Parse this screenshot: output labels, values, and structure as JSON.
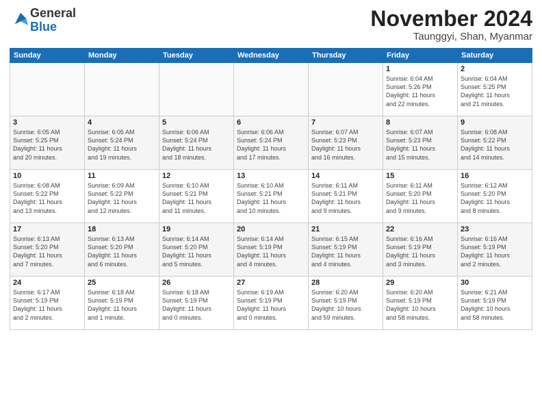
{
  "logo": {
    "general": "General",
    "blue": "Blue"
  },
  "title": "November 2024",
  "location": "Taunggyi, Shan, Myanmar",
  "weekdays": [
    "Sunday",
    "Monday",
    "Tuesday",
    "Wednesday",
    "Thursday",
    "Friday",
    "Saturday"
  ],
  "weeks": [
    [
      {
        "day": "",
        "info": ""
      },
      {
        "day": "",
        "info": ""
      },
      {
        "day": "",
        "info": ""
      },
      {
        "day": "",
        "info": ""
      },
      {
        "day": "",
        "info": ""
      },
      {
        "day": "1",
        "info": "Sunrise: 6:04 AM\nSunset: 5:26 PM\nDaylight: 11 hours\nand 22 minutes."
      },
      {
        "day": "2",
        "info": "Sunrise: 6:04 AM\nSunset: 5:25 PM\nDaylight: 11 hours\nand 21 minutes."
      }
    ],
    [
      {
        "day": "3",
        "info": "Sunrise: 6:05 AM\nSunset: 5:25 PM\nDaylight: 11 hours\nand 20 minutes."
      },
      {
        "day": "4",
        "info": "Sunrise: 6:05 AM\nSunset: 5:24 PM\nDaylight: 11 hours\nand 19 minutes."
      },
      {
        "day": "5",
        "info": "Sunrise: 6:06 AM\nSunset: 5:24 PM\nDaylight: 11 hours\nand 18 minutes."
      },
      {
        "day": "6",
        "info": "Sunrise: 6:06 AM\nSunset: 5:24 PM\nDaylight: 11 hours\nand 17 minutes."
      },
      {
        "day": "7",
        "info": "Sunrise: 6:07 AM\nSunset: 5:23 PM\nDaylight: 11 hours\nand 16 minutes."
      },
      {
        "day": "8",
        "info": "Sunrise: 6:07 AM\nSunset: 5:23 PM\nDaylight: 11 hours\nand 15 minutes."
      },
      {
        "day": "9",
        "info": "Sunrise: 6:08 AM\nSunset: 5:22 PM\nDaylight: 11 hours\nand 14 minutes."
      }
    ],
    [
      {
        "day": "10",
        "info": "Sunrise: 6:08 AM\nSunset: 5:22 PM\nDaylight: 11 hours\nand 13 minutes."
      },
      {
        "day": "11",
        "info": "Sunrise: 6:09 AM\nSunset: 5:22 PM\nDaylight: 11 hours\nand 12 minutes."
      },
      {
        "day": "12",
        "info": "Sunrise: 6:10 AM\nSunset: 5:21 PM\nDaylight: 11 hours\nand 11 minutes."
      },
      {
        "day": "13",
        "info": "Sunrise: 6:10 AM\nSunset: 5:21 PM\nDaylight: 11 hours\nand 10 minutes."
      },
      {
        "day": "14",
        "info": "Sunrise: 6:11 AM\nSunset: 5:21 PM\nDaylight: 11 hours\nand 9 minutes."
      },
      {
        "day": "15",
        "info": "Sunrise: 6:11 AM\nSunset: 5:20 PM\nDaylight: 11 hours\nand 9 minutes."
      },
      {
        "day": "16",
        "info": "Sunrise: 6:12 AM\nSunset: 5:20 PM\nDaylight: 11 hours\nand 8 minutes."
      }
    ],
    [
      {
        "day": "17",
        "info": "Sunrise: 6:13 AM\nSunset: 5:20 PM\nDaylight: 11 hours\nand 7 minutes."
      },
      {
        "day": "18",
        "info": "Sunrise: 6:13 AM\nSunset: 5:20 PM\nDaylight: 11 hours\nand 6 minutes."
      },
      {
        "day": "19",
        "info": "Sunrise: 6:14 AM\nSunset: 5:20 PM\nDaylight: 11 hours\nand 5 minutes."
      },
      {
        "day": "20",
        "info": "Sunrise: 6:14 AM\nSunset: 5:19 PM\nDaylight: 11 hours\nand 4 minutes."
      },
      {
        "day": "21",
        "info": "Sunrise: 6:15 AM\nSunset: 5:19 PM\nDaylight: 11 hours\nand 4 minutes."
      },
      {
        "day": "22",
        "info": "Sunrise: 6:16 AM\nSunset: 5:19 PM\nDaylight: 11 hours\nand 3 minutes."
      },
      {
        "day": "23",
        "info": "Sunrise: 6:16 AM\nSunset: 5:19 PM\nDaylight: 11 hours\nand 2 minutes."
      }
    ],
    [
      {
        "day": "24",
        "info": "Sunrise: 6:17 AM\nSunset: 5:19 PM\nDaylight: 11 hours\nand 2 minutes."
      },
      {
        "day": "25",
        "info": "Sunrise: 6:18 AM\nSunset: 5:19 PM\nDaylight: 11 hours\nand 1 minute."
      },
      {
        "day": "26",
        "info": "Sunrise: 6:18 AM\nSunset: 5:19 PM\nDaylight: 11 hours\nand 0 minutes."
      },
      {
        "day": "27",
        "info": "Sunrise: 6:19 AM\nSunset: 5:19 PM\nDaylight: 11 hours\nand 0 minutes."
      },
      {
        "day": "28",
        "info": "Sunrise: 6:20 AM\nSunset: 5:19 PM\nDaylight: 10 hours\nand 59 minutes."
      },
      {
        "day": "29",
        "info": "Sunrise: 6:20 AM\nSunset: 5:19 PM\nDaylight: 10 hours\nand 58 minutes."
      },
      {
        "day": "30",
        "info": "Sunrise: 6:21 AM\nSunset: 5:19 PM\nDaylight: 10 hours\nand 58 minutes."
      }
    ]
  ]
}
